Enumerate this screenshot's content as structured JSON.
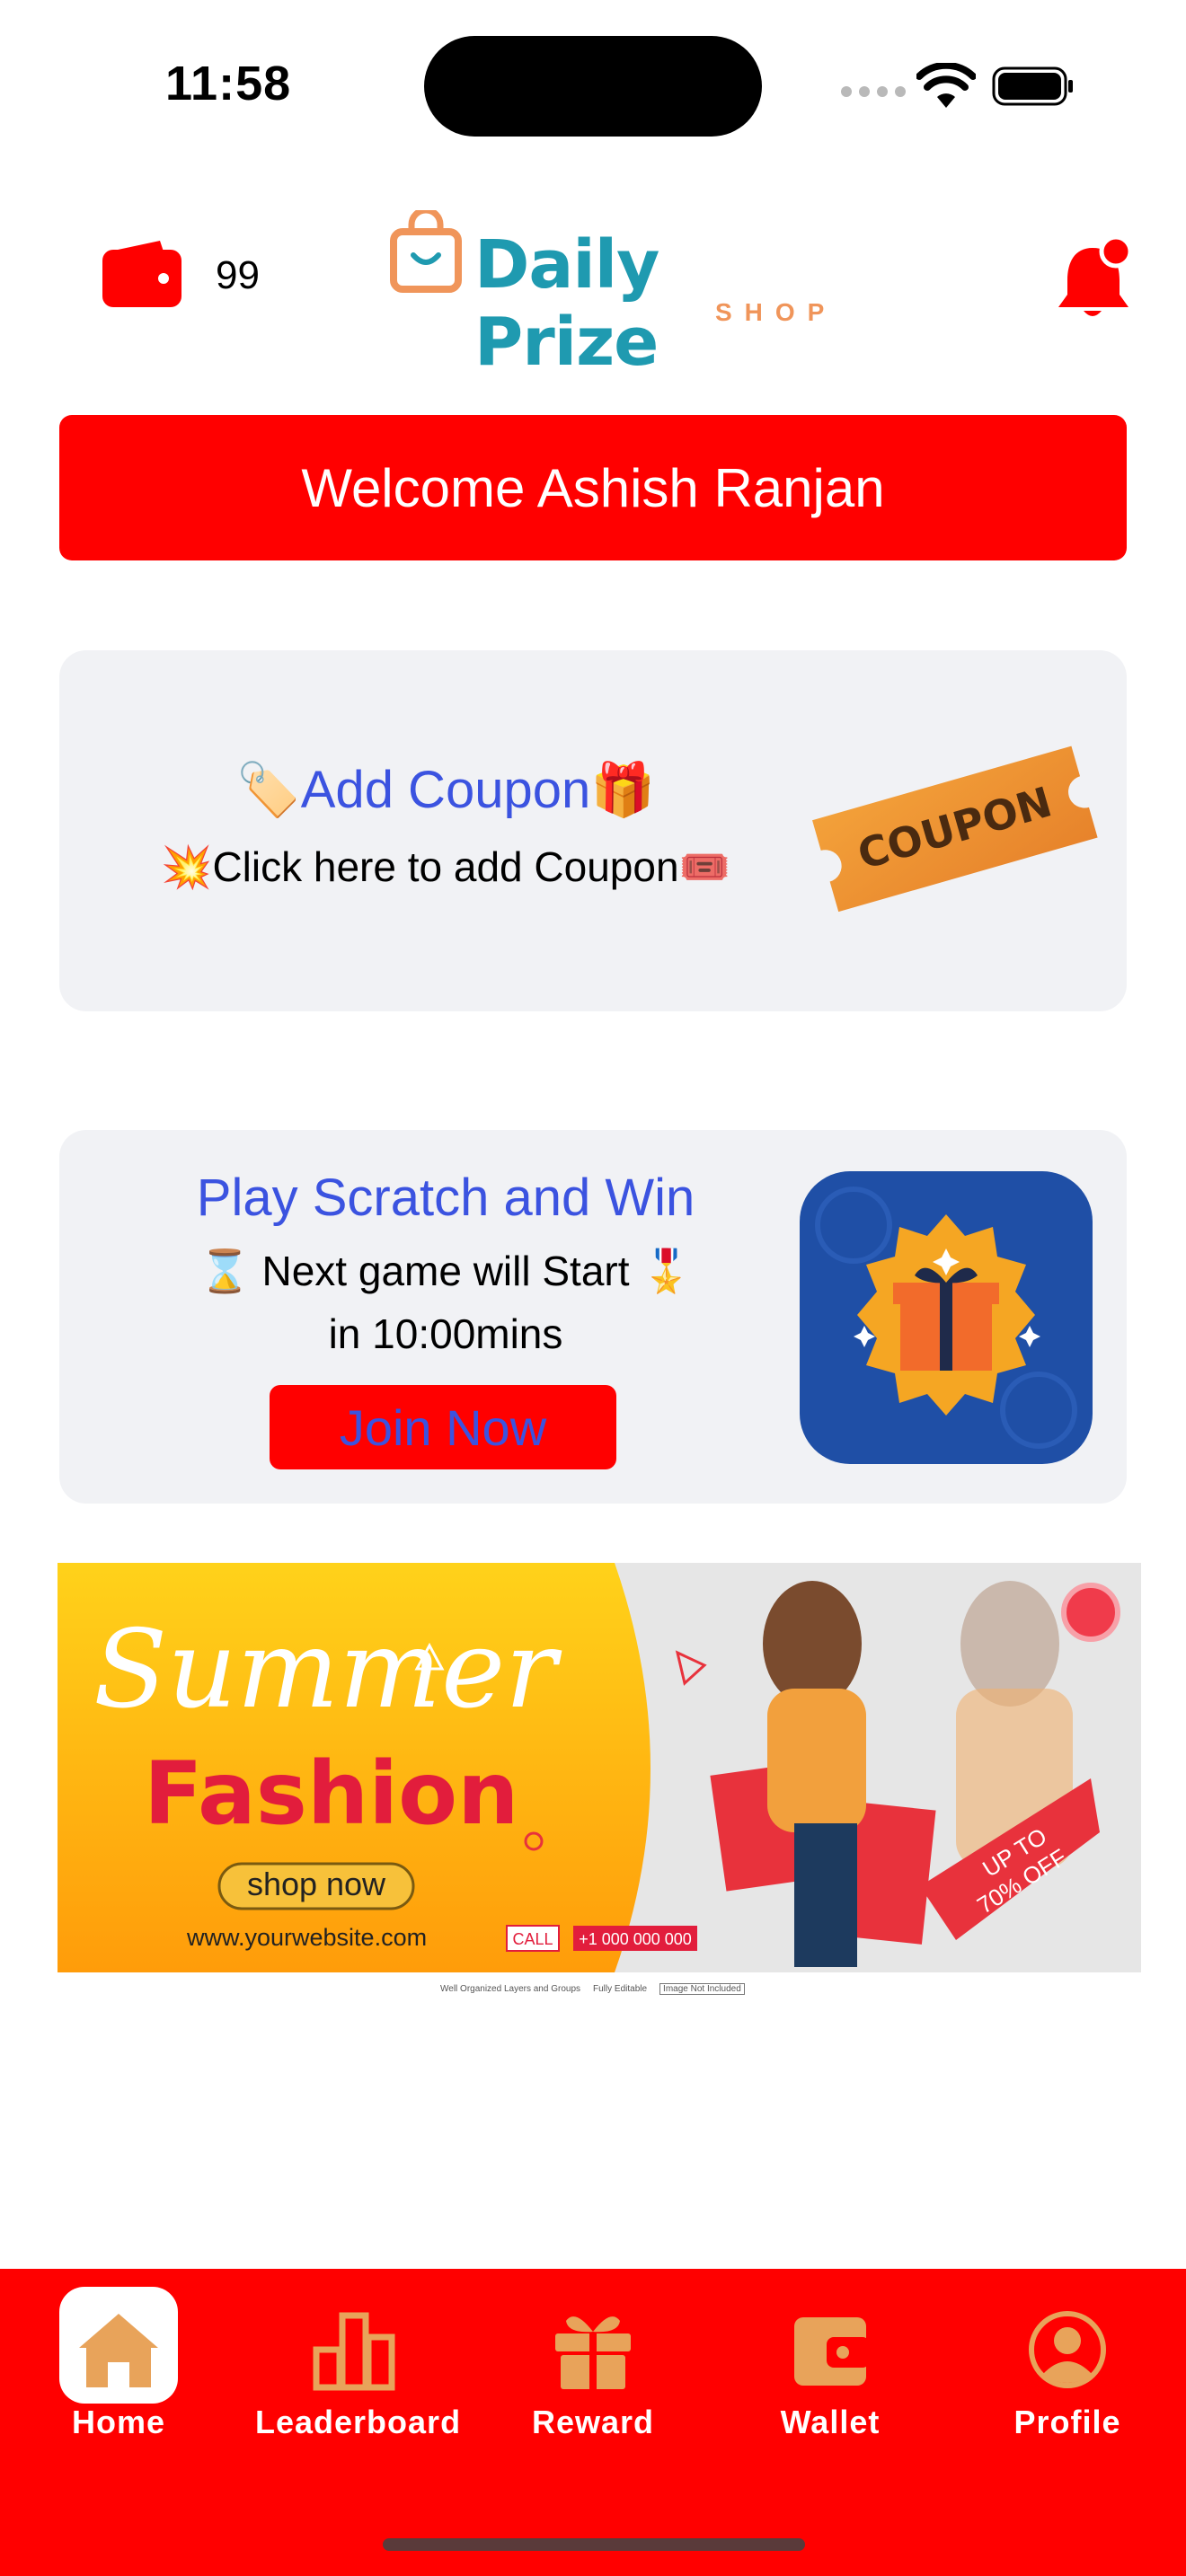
{
  "status_bar": {
    "time": "11:58"
  },
  "header": {
    "wallet_count": "99",
    "logo_title": "Daily Prize",
    "logo_subtitle": "SHOP"
  },
  "welcome": {
    "text": "Welcome Ashish Ranjan"
  },
  "coupon_card": {
    "title": "🏷️Add Coupon🎁",
    "subtitle": "💥Click here to add Coupon🎟️",
    "image_text": "COUPON"
  },
  "scratch_card": {
    "title": "Play Scratch and Win",
    "line1": "⌛ Next game will Start 🎖️",
    "line2": "in 10:00mins",
    "button": "Join Now"
  },
  "banner": {
    "headline1": "Summer",
    "headline2": "Fashion",
    "cta": "shop now",
    "website": "www.yourwebsite.com",
    "call_label": "CALL",
    "phone": "+1 000 000 000",
    "offer_line1": "UP TO",
    "offer_line2": "70% OFF",
    "footer": [
      "Well Organized Layers and Groups",
      "Fully Editable",
      "Image Not Included"
    ]
  },
  "tabbar": {
    "tabs": [
      {
        "label": "Home",
        "icon": "home-icon",
        "active": true
      },
      {
        "label": "Leaderboard",
        "icon": "leaderboard-icon",
        "active": false
      },
      {
        "label": "Reward",
        "icon": "gift-icon",
        "active": false
      },
      {
        "label": "Wallet",
        "icon": "wallet-icon",
        "active": false
      },
      {
        "label": "Profile",
        "icon": "profile-icon",
        "active": false
      }
    ]
  },
  "colors": {
    "primary_red": "#ff0000",
    "accent_blue": "#3b53e0",
    "logo_teal": "#1f9ab0",
    "logo_orange": "#f0955a",
    "tab_icon": "#e8a35a",
    "card_bg": "#f1f2f5"
  }
}
